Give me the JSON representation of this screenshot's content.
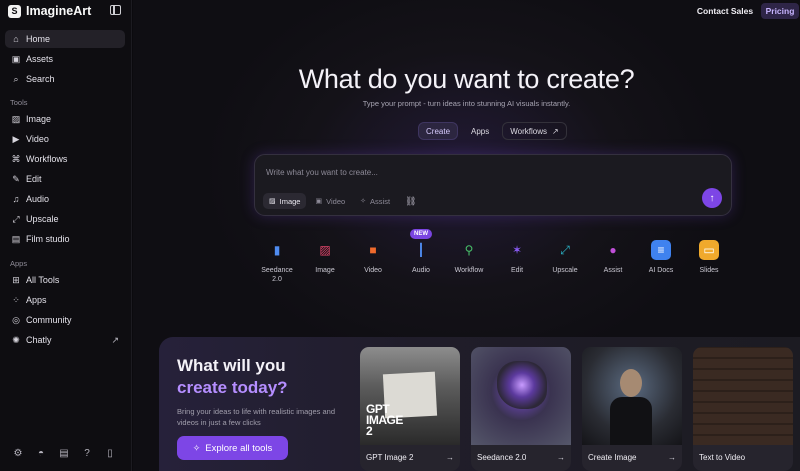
{
  "app": {
    "name": "ImagineArt"
  },
  "sidebar": {
    "nav": [
      {
        "label": "Home",
        "icon": "home-icon",
        "active": true
      },
      {
        "label": "Assets",
        "icon": "assets-icon"
      },
      {
        "label": "Search",
        "icon": "search-icon"
      }
    ],
    "tools_label": "Tools",
    "tools": [
      {
        "label": "Image",
        "icon": "image-icon"
      },
      {
        "label": "Video",
        "icon": "video-icon"
      },
      {
        "label": "Workflows",
        "icon": "workflows-icon"
      },
      {
        "label": "Edit",
        "icon": "edit-icon"
      },
      {
        "label": "Audio",
        "icon": "audio-icon"
      },
      {
        "label": "Upscale",
        "icon": "upscale-icon"
      },
      {
        "label": "Film studio",
        "icon": "film-icon"
      }
    ],
    "apps_label": "Apps",
    "apps": [
      {
        "label": "All Tools",
        "icon": "grid-icon"
      },
      {
        "label": "Apps",
        "icon": "apps-icon"
      },
      {
        "label": "Community",
        "icon": "globe-icon"
      },
      {
        "label": "Chatly",
        "icon": "chatly-icon",
        "external": true
      }
    ],
    "bottom_icons": [
      "settings-icon",
      "discord-icon",
      "docs-icon",
      "help-icon",
      "mobile-icon"
    ]
  },
  "topbar": {
    "contact": "Contact Sales",
    "pricing": "Pricing"
  },
  "hero": {
    "title": "What do you want to create?",
    "subtitle": "Type your prompt - turn ideas into stunning AI visuals instantly."
  },
  "tabs": [
    {
      "label": "Create",
      "active": true
    },
    {
      "label": "Apps"
    },
    {
      "label": "Workflows",
      "external": true
    }
  ],
  "prompt": {
    "placeholder": "Write what you want to create...",
    "modes": [
      {
        "label": "Image",
        "active": true
      },
      {
        "label": "Video"
      },
      {
        "label": "Assist"
      }
    ]
  },
  "tools_row": [
    {
      "label": "Seedance 2.0",
      "icon": "seedance-icon",
      "color": "#4f8cf0"
    },
    {
      "label": "Image",
      "icon": "image-icon",
      "color": "#e2456a"
    },
    {
      "label": "Video",
      "icon": "video-icon",
      "color": "#ef6a2c"
    },
    {
      "label": "Audio",
      "icon": "audio-icon",
      "color": "#4f8cf0",
      "badge": "NEW"
    },
    {
      "label": "Workflow",
      "icon": "workflow-icon",
      "color": "#48c06a"
    },
    {
      "label": "Edit",
      "icon": "edit-icon",
      "color": "#8b5cf6"
    },
    {
      "label": "Upscale",
      "icon": "upscale-icon",
      "color": "#2bb6c9"
    },
    {
      "label": "Assist",
      "icon": "assist-icon",
      "color": "#c04fd8"
    },
    {
      "label": "AI Docs",
      "icon": "docs-icon",
      "color": "#3f82ef"
    },
    {
      "label": "Slides",
      "icon": "slides-icon",
      "color": "#f0a92c"
    }
  ],
  "promo": {
    "title_line1": "What will you",
    "title_line2": "create today?",
    "description": "Bring your ideas to life with realistic images and videos in just a few clicks",
    "cta": "Explore all tools",
    "gpt_thumb_text": "GPT IMAGE 2",
    "cards": [
      {
        "label": "GPT Image 2"
      },
      {
        "label": "Seedance 2.0"
      },
      {
        "label": "Create Image"
      },
      {
        "label": "Text to Video"
      }
    ]
  }
}
